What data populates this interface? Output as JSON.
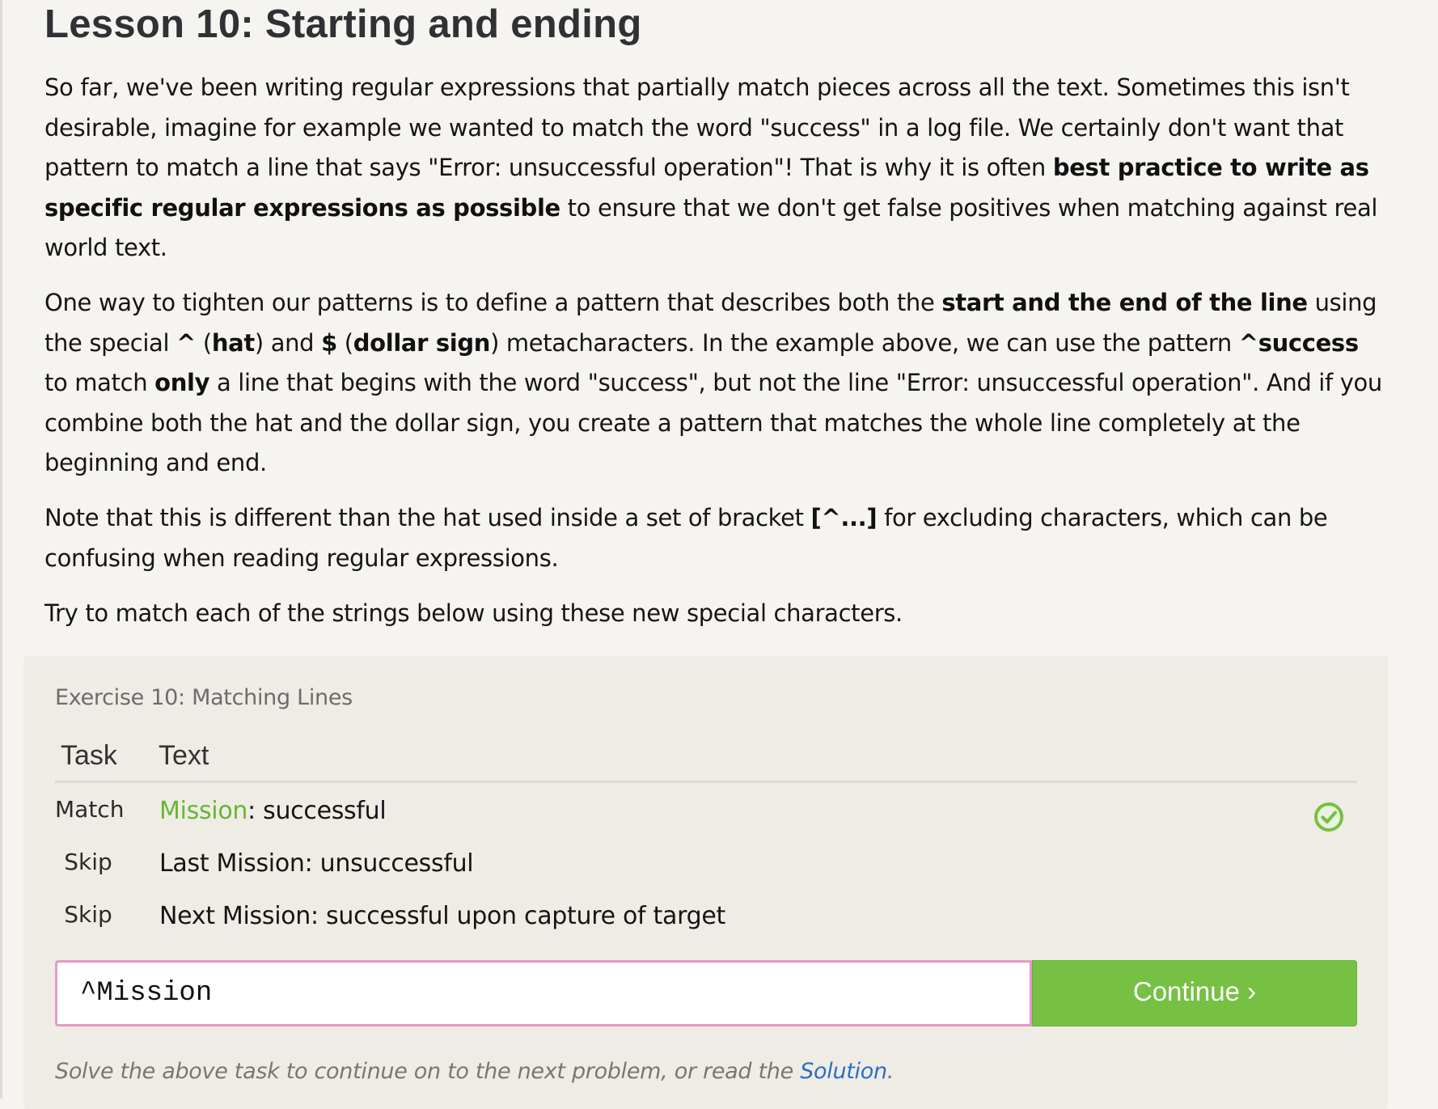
{
  "lesson": {
    "title": "Lesson 10: Starting and ending",
    "p1": {
      "a": "So far, we've been writing regular expressions that partially match pieces across all the text. Sometimes this isn't desirable, imagine for example we wanted to match the word \"success\" in a log file. We certainly don't want that pattern to match a line that says \"Error: unsuccessful operation\"! That is why it is often ",
      "b1": "best practice to write as specific regular expressions as possible",
      "c": " to ensure that we don't get false positives when matching against real world text."
    },
    "p2": {
      "a": "One way to tighten our patterns is to define a pattern that describes both the ",
      "b1": "start and the end of the line",
      "c": " using the special ",
      "b2": "^",
      "d": " (",
      "b3": "hat",
      "e": ") and ",
      "b4": "$",
      "f": " (",
      "b5": "dollar sign",
      "g": ") metacharacters. In the example above, we can use the pattern ",
      "b6": "^success",
      "h": " to match ",
      "b7": "only",
      "i": " a line that begins with the word \"success\", but not the line \"Error: unsuccessful operation\". And if you combine both the hat and the dollar sign, you create a pattern that matches the whole line completely at the beginning and end."
    },
    "p3": {
      "a": "Note that this is different than the hat used inside a set of bracket ",
      "b1": "[^...]",
      "c": " for excluding characters, which can be confusing when reading regular expressions."
    },
    "p4": "Try to match each of the strings below using these new special characters."
  },
  "exercise": {
    "title": "Exercise 10: Matching Lines",
    "headers": {
      "task": "Task",
      "text": "Text"
    },
    "rows": [
      {
        "task": "Match",
        "highlight": "Mission",
        "rest": ": successful",
        "status": "check-circle-icon"
      },
      {
        "task": "Skip",
        "text": "Last Mission: unsuccessful"
      },
      {
        "task": "Skip",
        "text": "Next Mission: successful upon capture of target"
      }
    ],
    "input_value": "^Mission",
    "continue_label": "Continue ›",
    "hint_prefix": "Solve the above task to continue on to the next problem, or read the ",
    "hint_link": "Solution",
    "hint_suffix": "."
  },
  "colors": {
    "accent_green": "#76c043",
    "match_highlight": "#6ab533",
    "input_border": "#e59ac4",
    "link": "#2a6fc2"
  }
}
